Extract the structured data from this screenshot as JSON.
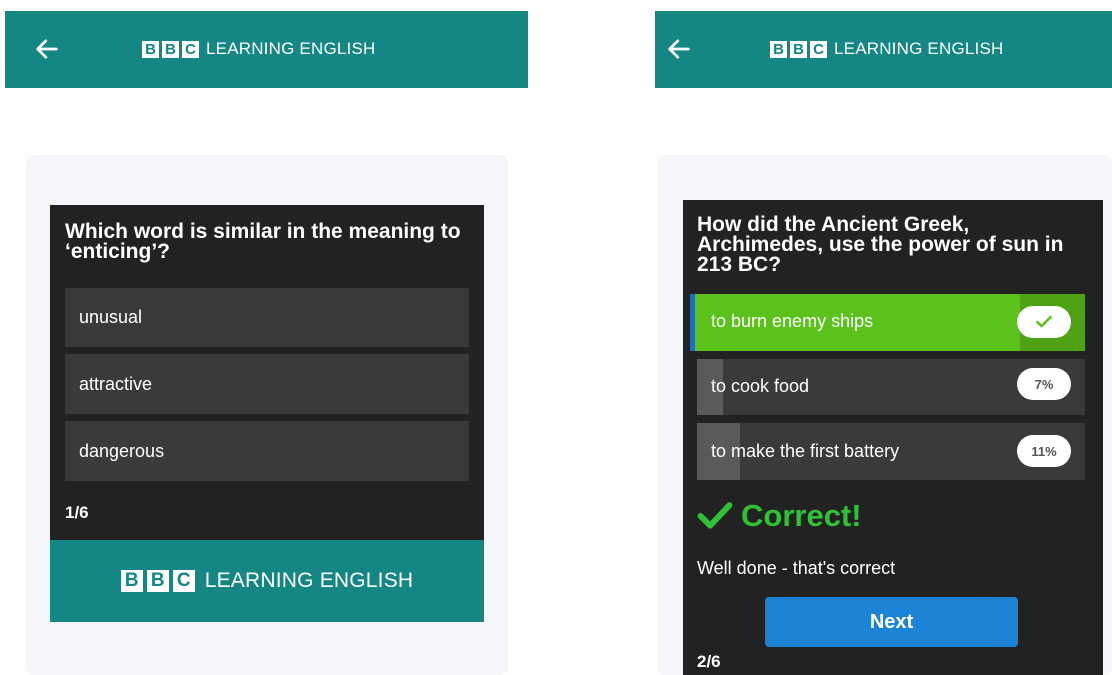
{
  "brand": {
    "bbc_letters": [
      "B",
      "B",
      "C"
    ],
    "title": "LEARNING ENGLISH"
  },
  "left_screen": {
    "question": "Which word is similar in the meaning to ‘enticing’?",
    "options": [
      "unusual",
      "attractive",
      "dangerous"
    ],
    "counter": "1/6"
  },
  "right_screen": {
    "question": "How did the Ancient Greek, Archimedes, use the power of sun in 213 BC?",
    "answers": [
      {
        "label": "to burn enemy ships",
        "correct": true,
        "share": null
      },
      {
        "label": "to cook food",
        "correct": false,
        "percent": "7%",
        "share": 0.07
      },
      {
        "label": "to make the first battery",
        "correct": false,
        "percent": "11%",
        "share": 0.11
      }
    ],
    "result_title": "Correct!",
    "feedback": "Well done - that's correct",
    "next_label": "Next",
    "counter": "2/6"
  },
  "colors": {
    "header": "#148683",
    "quiz_bg": "#222222",
    "option_bg": "#3a3a3a",
    "correct_green": "#5ac21a",
    "correct_text": "#2fc234",
    "next_button": "#1d83d4"
  },
  "icons": [
    "back-arrow-icon",
    "check-icon"
  ]
}
